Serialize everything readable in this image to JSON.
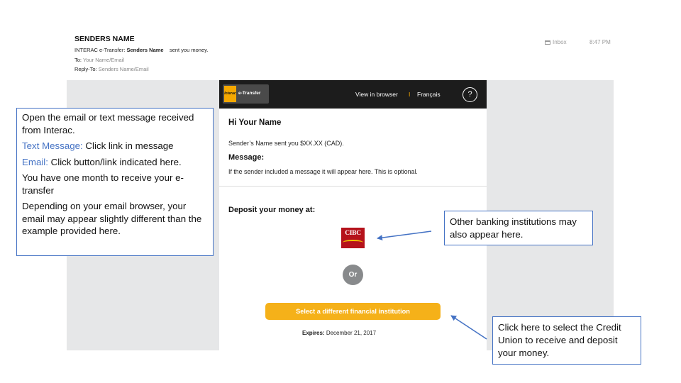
{
  "email_header": {
    "sender_name": "SENDERS NAME",
    "subject_prefix": "INTERAC e-Transfer: ",
    "subject_sender": "Senders Name",
    "subject_suffix": "sent you money.",
    "to_label": "To:",
    "to_value": "Your Name/Email",
    "reply_to_label": "Reply-To:",
    "reply_to_value": "Senders Name/Email",
    "folder": "Inbox",
    "time": "8:47 PM"
  },
  "email_bar": {
    "logo_brand": "Interac",
    "logo_product": "e-Transfer",
    "view_in_browser": "View in browser",
    "separator": "I",
    "language": "Français",
    "help_icon": "?"
  },
  "email_body": {
    "greeting": "Hi Your Name",
    "sent_line": "Sender’s Name sent you $XX.XX (CAD).",
    "message_heading": "Message:",
    "message_text": "If the sender included a message it will appear here. This is optional.",
    "deposit_heading": "Deposit your money at:",
    "bank_logo_text": "CIBC",
    "or_label": "Or",
    "select_button": "Select a different financial institution",
    "expires_label": "Expires:",
    "expires_date": "December 21, 2017"
  },
  "annotations": {
    "instructions": {
      "intro": "Open the email or text message received from Interac.",
      "text_label": "Text Message:",
      "text_detail": " Click link in message",
      "email_label": "Email:",
      "email_detail": " Click button/link indicated here.",
      "month": "You have one month to receive your e-transfer",
      "browser_note": "Depending on your email browser, your email may appear slightly different than the example provided here."
    },
    "other_banks": "Other banking institutions may also appear here.",
    "credit_union": "Click here to select the Credit Union to receive and deposit your money."
  },
  "colors": {
    "callout_border": "#4472c4",
    "interac_yellow": "#f5a800",
    "button_yellow": "#f5b119",
    "bar_black": "#1c1c1c"
  }
}
